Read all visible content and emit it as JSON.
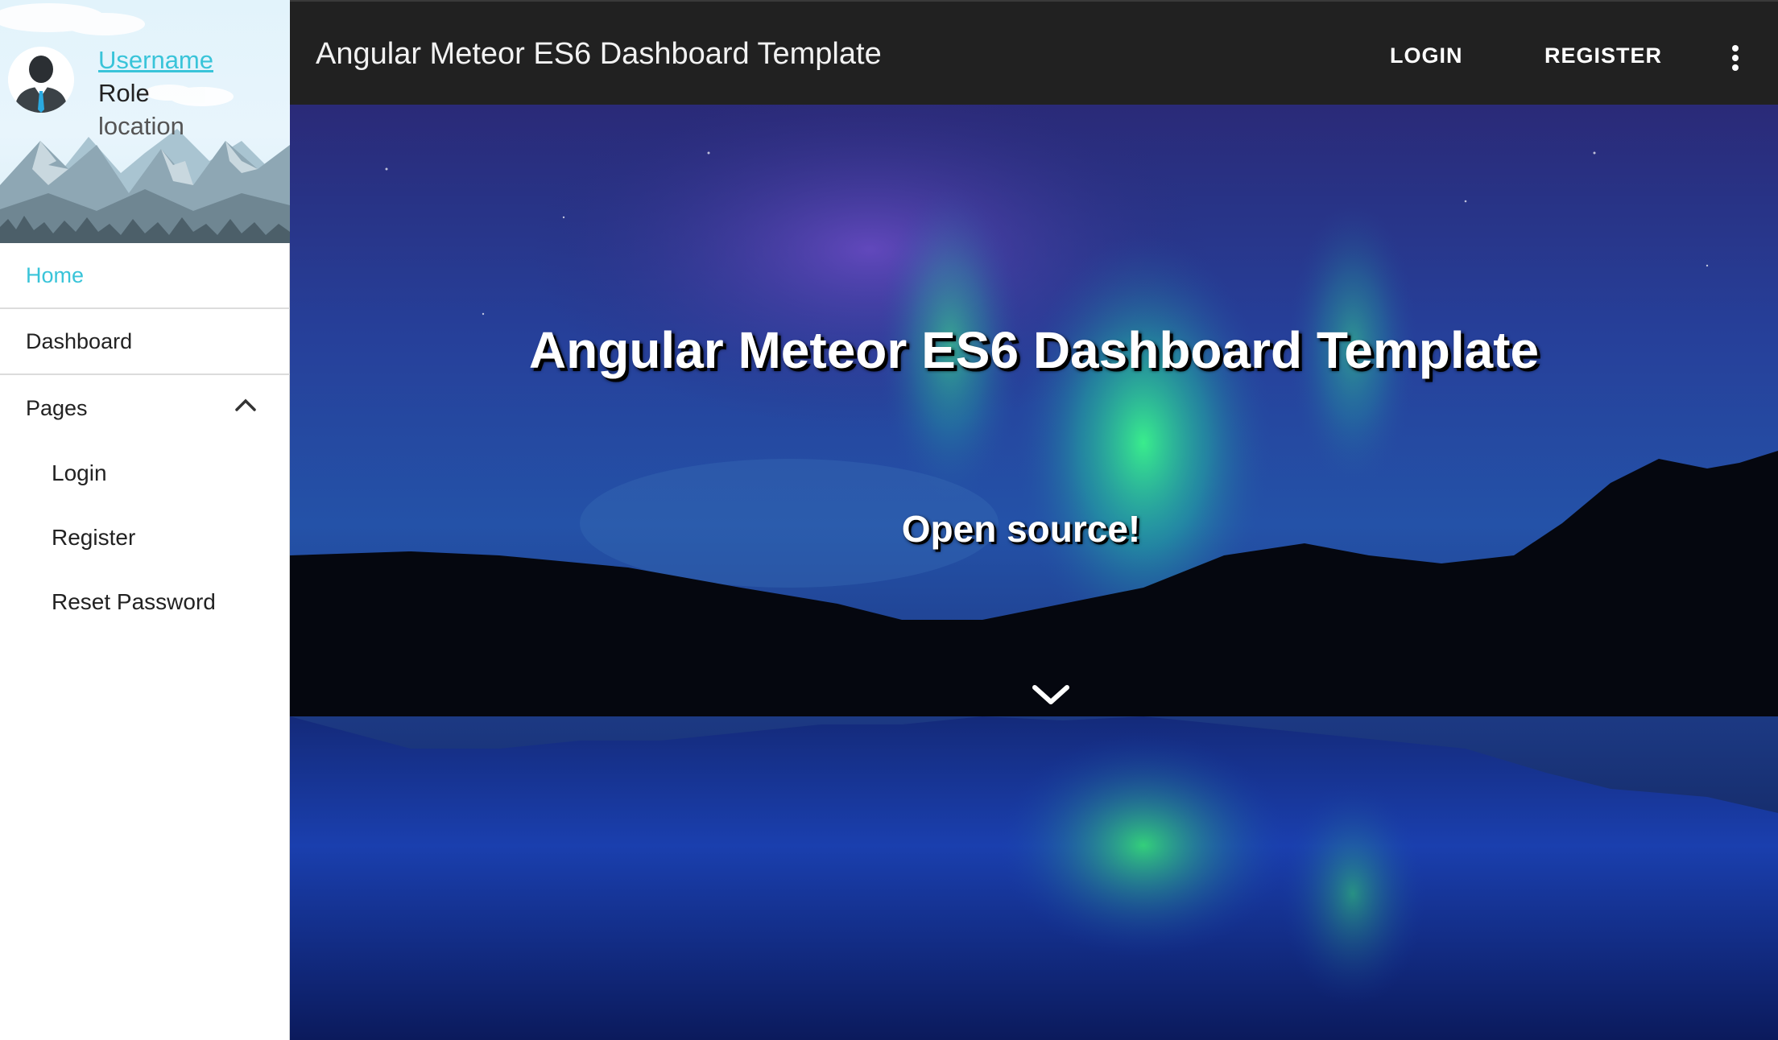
{
  "sidebar": {
    "profile": {
      "username": "Username",
      "role": "Role",
      "location": "location",
      "avatar_icon": "user-avatar-icon"
    },
    "menu": {
      "home": "Home",
      "dashboard": "Dashboard",
      "pages": "Pages",
      "pages_expanded": true,
      "submenu": {
        "login": "Login",
        "register": "Register",
        "reset_password": "Reset Password"
      }
    }
  },
  "topbar": {
    "title": "Angular Meteor ES6 Dashboard Template",
    "login_label": "LOGIN",
    "register_label": "REGISTER",
    "more_icon": "more-vert-icon"
  },
  "hero": {
    "title": "Angular Meteor ES6 Dashboard Template",
    "subtitle": "Open source!",
    "scroll_icon": "chevron-down-icon"
  },
  "colors": {
    "accent": "#39c4d9",
    "topbar_bg": "#212121",
    "sidebar_bg": "#ffffff",
    "text_dark": "#222222"
  }
}
